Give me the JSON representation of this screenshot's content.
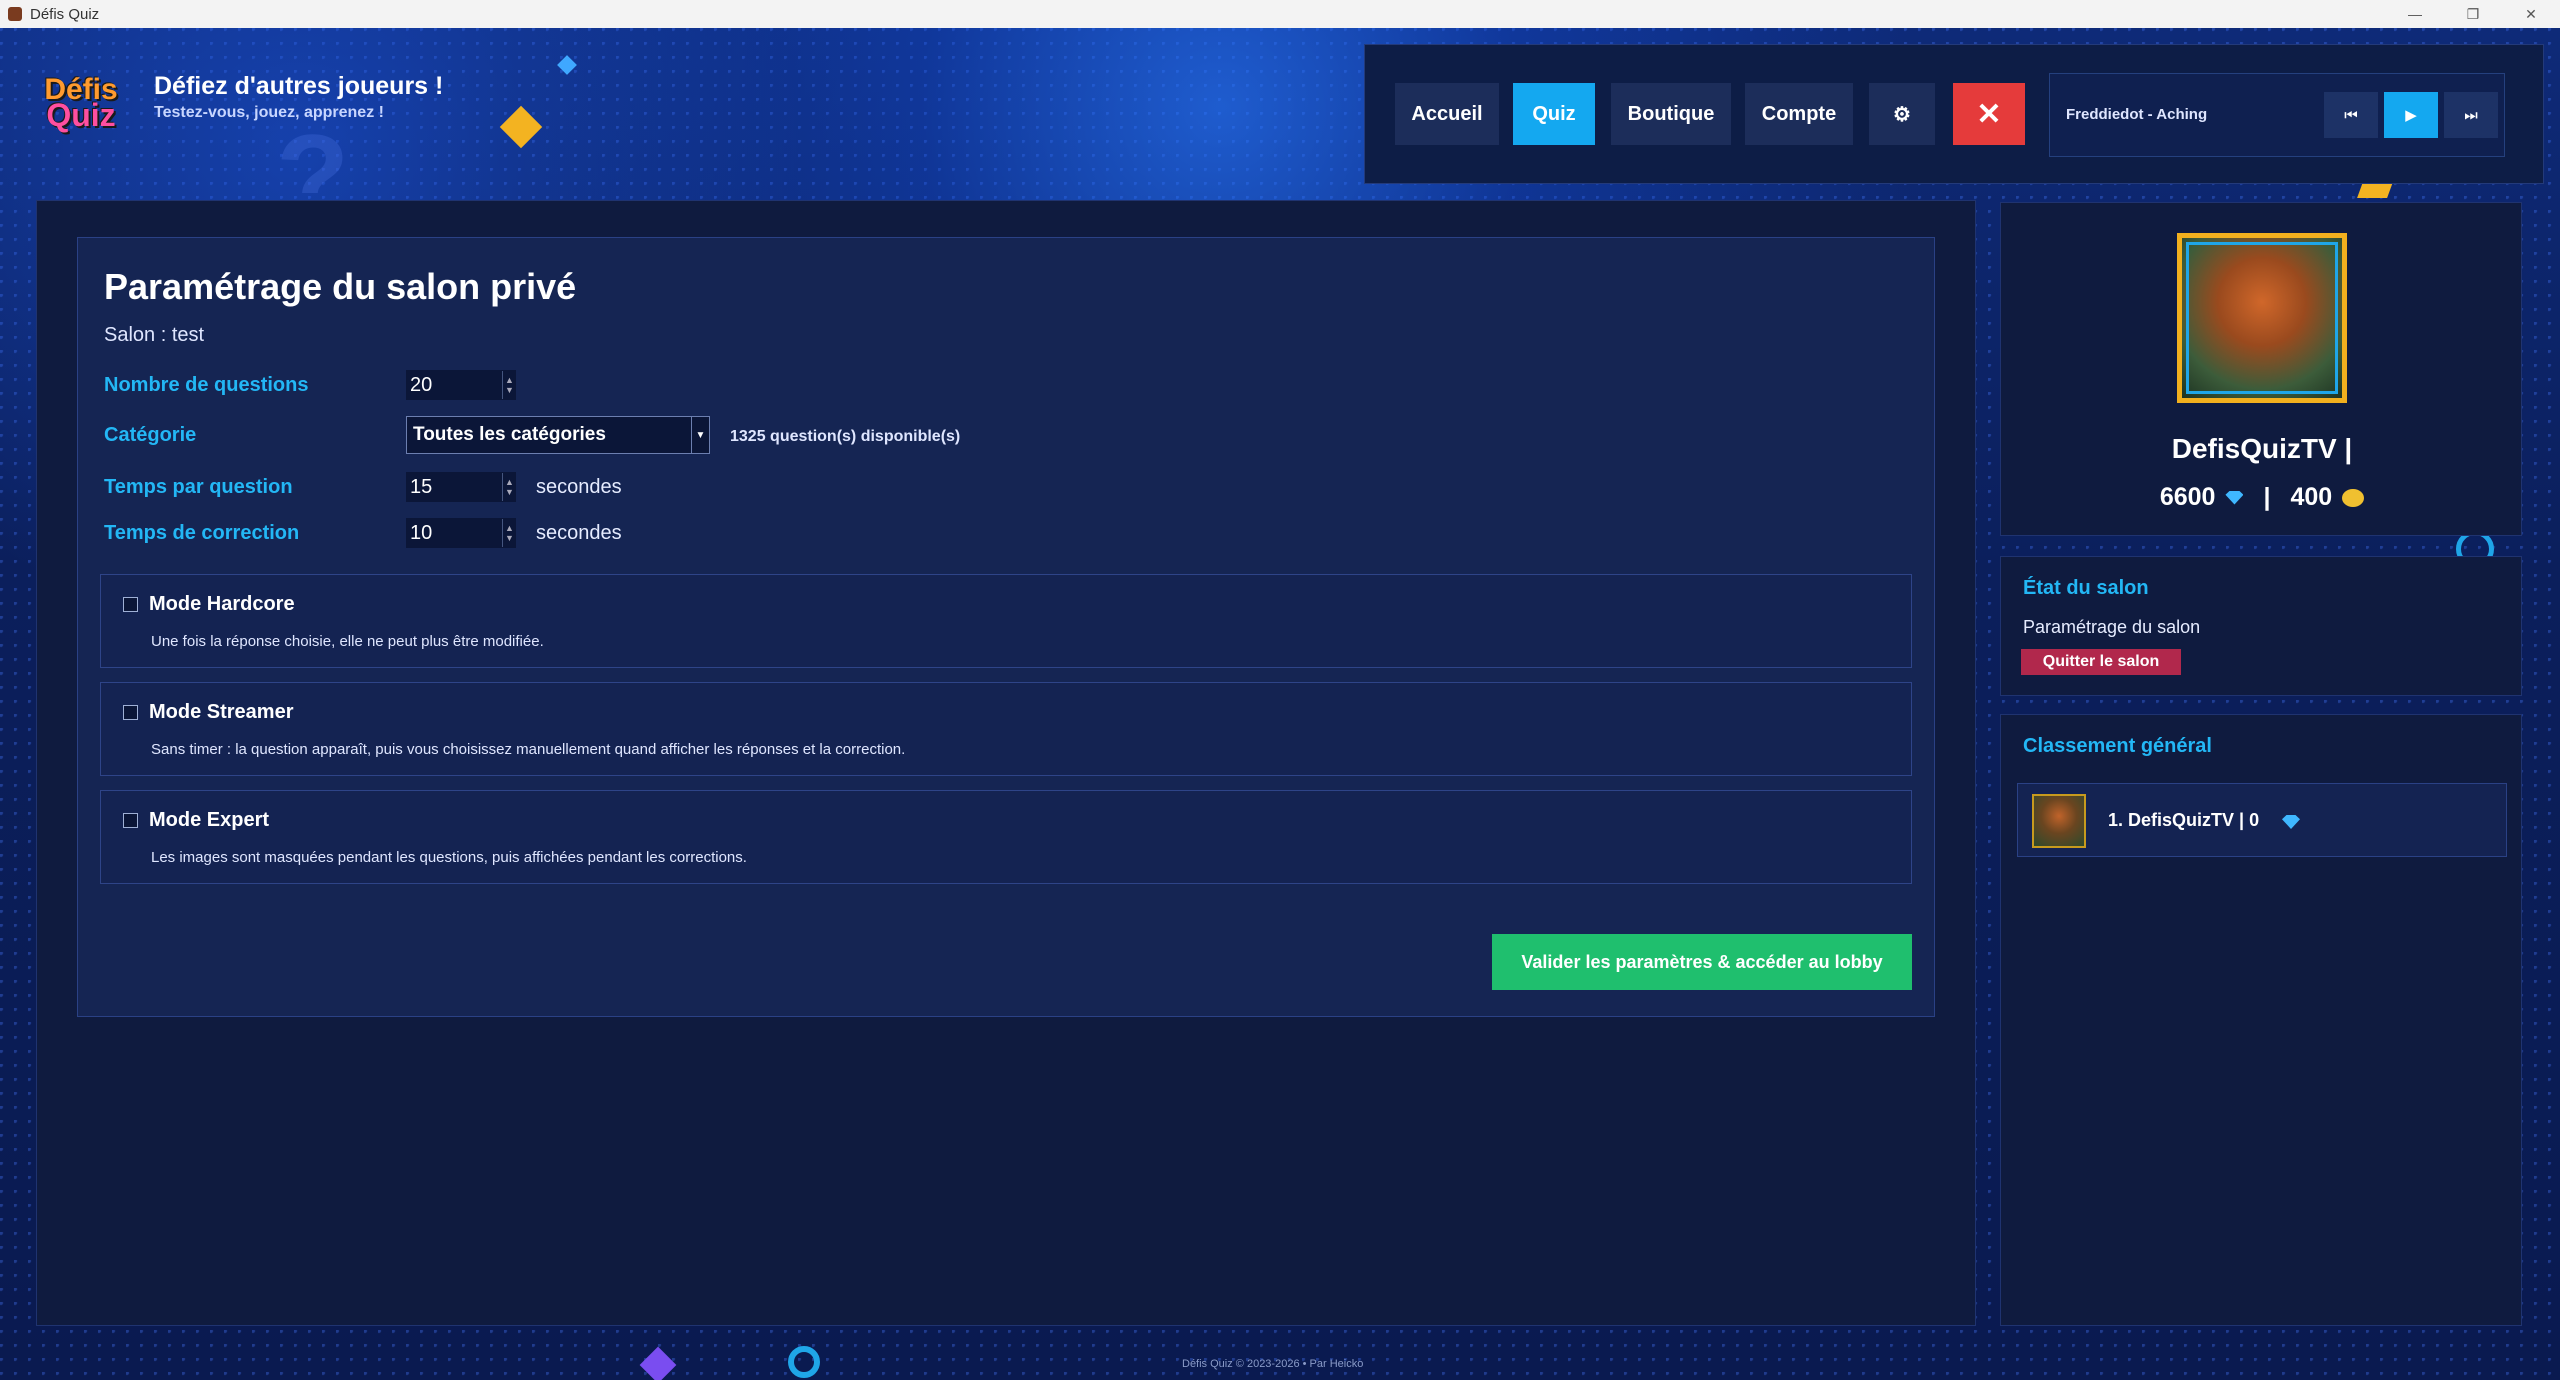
{
  "window": {
    "title": "Défis Quiz",
    "controls": [
      "—",
      "❐",
      "✕"
    ]
  },
  "header": {
    "logo_line1": "Défis",
    "logo_line2": "Quiz",
    "title": "Défiez d'autres joueurs !",
    "subtitle": "Testez-vous, jouez, apprenez !"
  },
  "nav": {
    "items": [
      {
        "label": "Accueil",
        "active": false
      },
      {
        "label": "Quiz",
        "active": true
      },
      {
        "label": "Boutique",
        "active": false
      },
      {
        "label": "Compte",
        "active": false
      }
    ],
    "settings_icon": "⚙",
    "close_icon": "✕",
    "player": "Freddiedot - Aching",
    "player_buttons": [
      "⏮",
      "▶",
      "⏭"
    ]
  },
  "settings": {
    "title": "Paramétrage du salon privé",
    "salon": "Salon : test",
    "questions_label": "Nombre de questions",
    "questions_value": "20",
    "category_label": "Catégorie",
    "category_value": "Toutes les catégories",
    "available": "1325 question(s) disponible(s)",
    "time_label": "Temps par question",
    "time_value": "15",
    "correction_label": "Temps de correction",
    "correction_value": "10",
    "unit": "secondes",
    "modes": [
      {
        "title": "Mode Hardcore",
        "desc": "Une fois la réponse choisie, elle ne peut plus être modifiée.",
        "checked": false
      },
      {
        "title": "Mode Streamer",
        "desc": "Sans timer : la question apparaît, puis vous choisissez manuellement quand afficher les réponses et la correction.",
        "checked": false
      },
      {
        "title": "Mode Expert",
        "desc": "Les images sont masquées pendant les questions, puis affichées pendant les corrections.",
        "checked": false
      }
    ],
    "validate": "Valider les paramètres & accéder au lobby"
  },
  "profile": {
    "name": "DefisQuizTV |",
    "gems": "6600",
    "separator": "|",
    "coins": "400"
  },
  "salon_state": {
    "title": "État du salon",
    "status": "Paramétrage du salon",
    "quit": "Quitter le salon"
  },
  "ranking": {
    "title": "Classement général",
    "rows": [
      {
        "text": "1. DefisQuizTV | 0"
      }
    ]
  },
  "footer": "Défis Quiz © 2023-2026 • Par Heicko"
}
